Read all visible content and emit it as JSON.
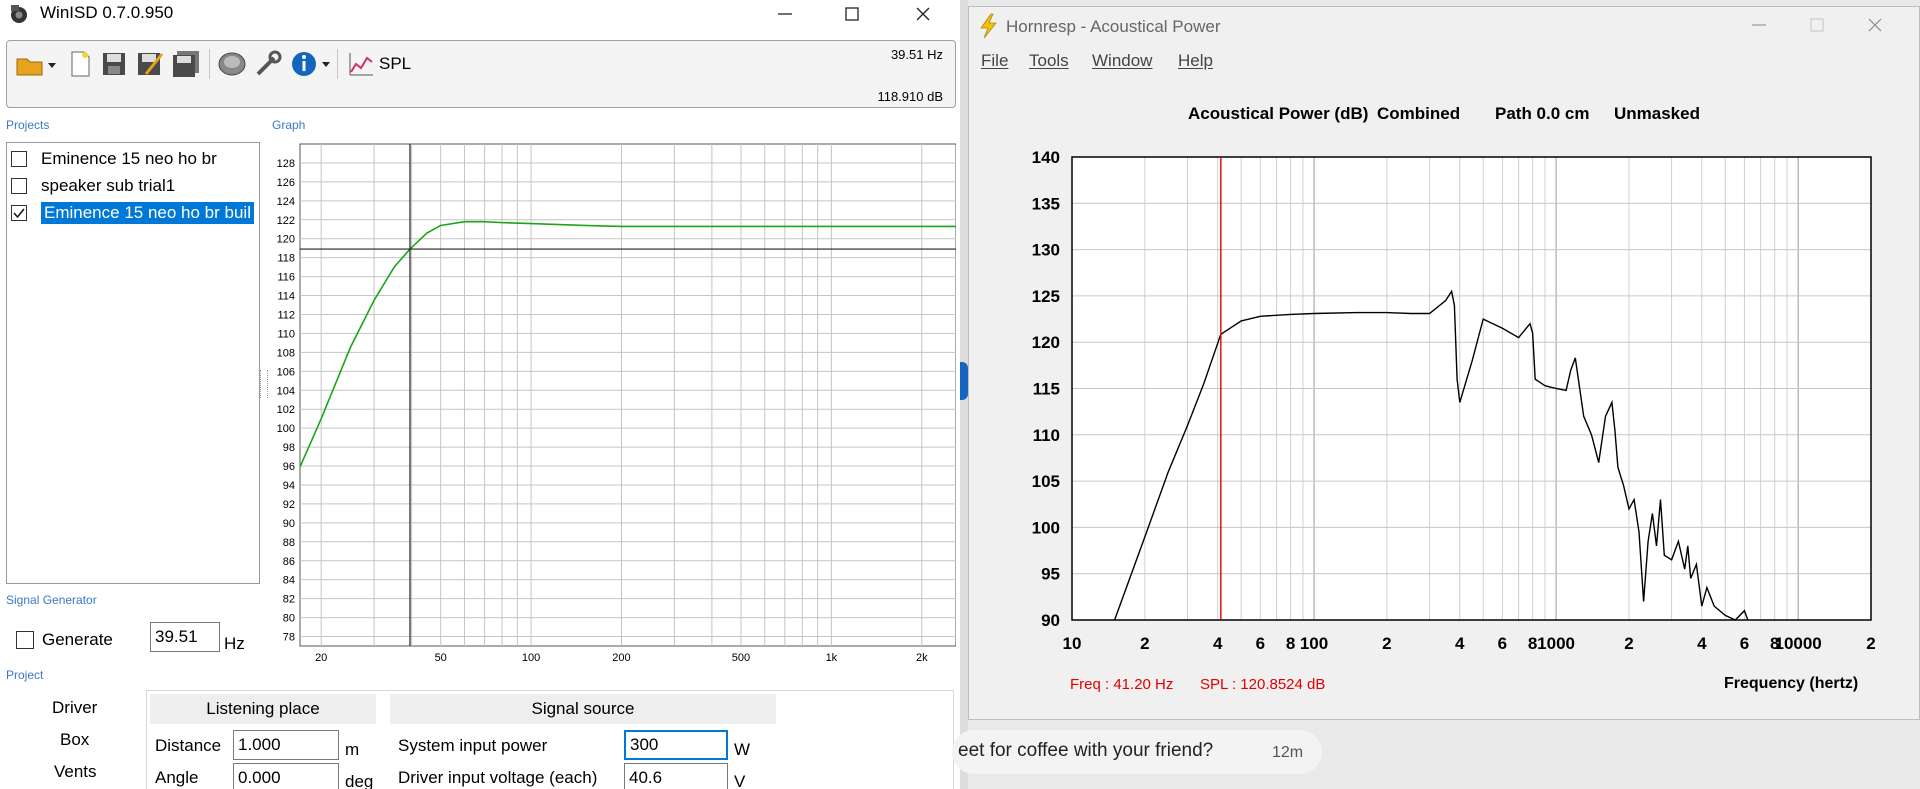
{
  "winisd": {
    "title": "WinISD 0.7.0.950",
    "toolbar": {
      "icons": [
        "open-folder-icon",
        "new-file-icon",
        "save-icon",
        "save-as-icon",
        "save-all-icon",
        "driver-icon",
        "tools-icon",
        "info-icon",
        "spl-chart-icon"
      ],
      "spl_label": "SPL",
      "freq_readout": "39.51 Hz",
      "db_readout": "118.910 dB"
    },
    "projects": {
      "label": "Projects",
      "items": [
        {
          "name": "Eminence 15 neo ho br",
          "checked": false,
          "selected": false
        },
        {
          "name": "speaker sub trial1",
          "checked": false,
          "selected": false
        },
        {
          "name": "Eminence 15 neo ho br buil",
          "checked": true,
          "selected": true
        }
      ]
    },
    "graph": {
      "label": "Graph",
      "y_ticks": [
        "128",
        "126",
        "124",
        "122",
        "120",
        "118",
        "116",
        "114",
        "112",
        "110",
        "108",
        "106",
        "104",
        "102",
        "100",
        "98",
        "96",
        "94",
        "92",
        "90",
        "88",
        "86",
        "84",
        "82",
        "80",
        "78"
      ],
      "x_ticks": [
        "20",
        "50",
        "100",
        "200",
        "500",
        "1k",
        "2k"
      ],
      "cursor_hz": 39.51,
      "cursor_db": 118.91
    },
    "signal_generator": {
      "label": "Signal Generator",
      "generate_label": "Generate",
      "freq_value": "39.51",
      "freq_unit": "Hz"
    },
    "project": {
      "label": "Project",
      "tabs": [
        "Driver",
        "Box",
        "Vents"
      ],
      "listening_place": {
        "header": "Listening place",
        "distance_label": "Distance",
        "distance_value": "1.000",
        "distance_unit": "m",
        "angle_label": "Angle",
        "angle_value": "0.000",
        "angle_unit": "deg"
      },
      "signal_source": {
        "header": "Signal source",
        "power_label": "System input power",
        "power_value": "300",
        "power_unit": "W",
        "voltage_label": "Driver input voltage (each)",
        "voltage_value": "40.6",
        "voltage_unit": "V"
      }
    }
  },
  "hornresp": {
    "title": "Hornresp - Acoustical Power",
    "menu": [
      "File",
      "Tools",
      "Window",
      "Help"
    ],
    "header": {
      "quantity": "Acoustical Power (dB)",
      "mode": "Combined",
      "path": "Path 0.0 cm",
      "mask": "Unmasked"
    },
    "y_ticks": [
      "140",
      "135",
      "130",
      "125",
      "120",
      "115",
      "110",
      "105",
      "100",
      "95",
      "90"
    ],
    "x_ticks": [
      "10",
      "2",
      "4",
      "6",
      "8",
      "100",
      "2",
      "4",
      "6",
      "8",
      "1000",
      "2",
      "4",
      "6",
      "8",
      "10000",
      "2"
    ],
    "status_freq": "Freq : 41.20 Hz",
    "status_spl": "SPL : 120.8524 dB",
    "x_label": "Frequency (hertz)"
  },
  "notification": {
    "text": "eet for coffee with your friend?",
    "time": "12m"
  },
  "chart_data": [
    {
      "type": "line",
      "title": "",
      "xlabel": "",
      "ylabel": "",
      "x_scale": "log",
      "xlim": [
        17,
        2600
      ],
      "ylim": [
        77,
        130
      ],
      "grid": true,
      "series": [
        {
          "color": "#1aa61a",
          "x": [
            17,
            20,
            25,
            30,
            35,
            39.51,
            45,
            50,
            60,
            70,
            80,
            100,
            150,
            200,
            300,
            500,
            1000,
            2000,
            2600
          ],
          "y": [
            95.9,
            101,
            108.5,
            113.5,
            117,
            118.91,
            120.6,
            121.4,
            121.8,
            121.8,
            121.7,
            121.6,
            121.4,
            121.3,
            121.3,
            121.3,
            121.3,
            121.3,
            121.3
          ]
        }
      ],
      "cursor": {
        "x": 39.51,
        "y": 118.91
      }
    },
    {
      "type": "line",
      "title": "Acoustical Power (dB)   Combined   Path 0.0 cm   Unmasked",
      "xlabel": "Frequency (hertz)",
      "ylabel": "",
      "x_scale": "log",
      "xlim": [
        10,
        20000
      ],
      "ylim": [
        90,
        140
      ],
      "grid": true,
      "series": [
        {
          "color": "#000000",
          "x": [
            15,
            20,
            25,
            30,
            35,
            41.2,
            50,
            60,
            80,
            100,
            150,
            200,
            250,
            300,
            350,
            370,
            380,
            390,
            400,
            450,
            500,
            600,
            700,
            780,
            800,
            820,
            900,
            1000,
            1100,
            1150,
            1200,
            1300,
            1400,
            1500,
            1600,
            1700,
            1750,
            1800,
            1900,
            2000,
            2100,
            2200,
            2300,
            2400,
            2500,
            2600,
            2700,
            2800,
            3000,
            3200,
            3400,
            3500,
            3600,
            3800,
            4000,
            4200,
            4500,
            5000,
            5500,
            6000,
            6200
          ],
          "y": [
            90,
            99,
            106,
            111,
            115.5,
            120.85,
            122.3,
            122.8,
            123,
            123.1,
            123.2,
            123.2,
            123.1,
            123.1,
            124.5,
            125.5,
            124,
            116,
            113.5,
            118,
            122.5,
            121.5,
            120.5,
            122,
            121,
            116,
            115.3,
            115,
            114.8,
            117,
            118.3,
            112,
            110,
            107,
            112,
            113.5,
            110.5,
            106.5,
            104.5,
            102,
            103,
            99.5,
            92,
            98.5,
            101.5,
            98,
            103,
            97,
            96.5,
            98.5,
            95.5,
            98,
            94.5,
            96,
            91.5,
            93.5,
            91.5,
            90.5,
            90,
            91,
            90
          ]
        }
      ],
      "cursor": {
        "x": 41.2,
        "y": 120.85
      }
    }
  ]
}
